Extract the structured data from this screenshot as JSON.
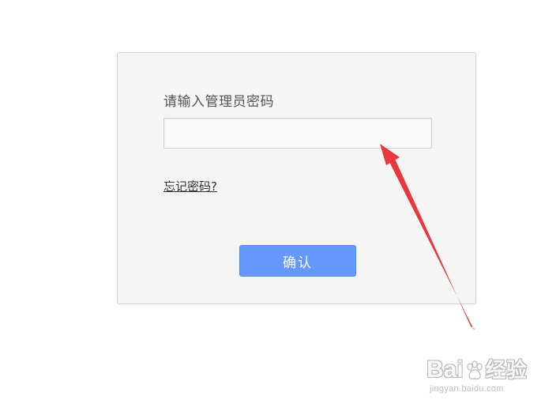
{
  "login": {
    "prompt_label": "请输入管理员密码",
    "password_value": "",
    "forgot_link": "忘记密码?",
    "confirm_button": "确认"
  },
  "annotation": {
    "arrow_color": "#e8383d"
  },
  "watermark": {
    "brand_left": "Bai",
    "brand_right": "经验",
    "url": "jingyan.baidu.com"
  },
  "colors": {
    "panel_background": "#f5f5f5",
    "button_background": "#6699ff",
    "button_text": "#ffffff"
  }
}
